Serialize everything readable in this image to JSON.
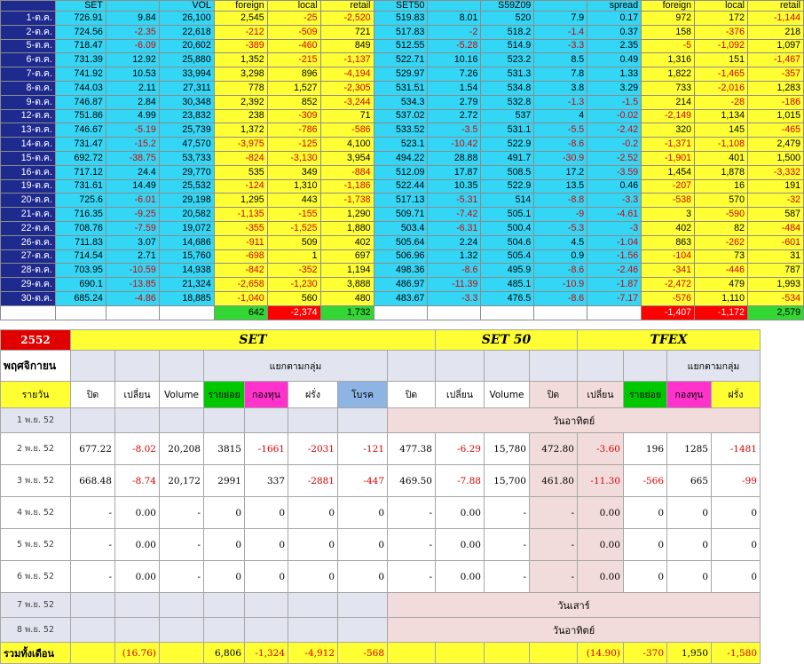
{
  "top_headers": [
    "",
    "SET",
    "",
    "VOL",
    "foreign",
    "local",
    "retail",
    "SET50",
    "",
    "S59Z09",
    "",
    "spread",
    "foreign",
    "local",
    "retail"
  ],
  "top_rows": [
    [
      "1-ต.ค.",
      "726.91",
      "9.84",
      "26,100",
      "2,545",
      "-25",
      "-2,520",
      "519.83",
      "8.01",
      "520",
      "7.9",
      "0.17",
      "972",
      "172",
      "-1,144"
    ],
    [
      "2-ต.ค.",
      "724.56",
      "-2.35",
      "22,618",
      "-212",
      "-509",
      "721",
      "517.83",
      "-2",
      "518.2",
      "-1.4",
      "0.37",
      "158",
      "-376",
      "218"
    ],
    [
      "5-ต.ค.",
      "718.47",
      "-6.09",
      "20,602",
      "-389",
      "-460",
      "849",
      "512.55",
      "-5.28",
      "514.9",
      "-3.3",
      "2.35",
      "-5",
      "-1,092",
      "1,097"
    ],
    [
      "6-ต.ค.",
      "731.39",
      "12.92",
      "25,880",
      "1,352",
      "-215",
      "-1,137",
      "522.71",
      "10.16",
      "523.2",
      "8.5",
      "0.49",
      "1,316",
      "151",
      "-1,467"
    ],
    [
      "7-ต.ค.",
      "741.92",
      "10.53",
      "33,994",
      "3,298",
      "896",
      "-4,194",
      "529.97",
      "7.26",
      "531.3",
      "7.8",
      "1.33",
      "1,822",
      "-1,465",
      "-357"
    ],
    [
      "8-ต.ค.",
      "744.03",
      "2.11",
      "27,311",
      "778",
      "1,527",
      "-2,305",
      "531.51",
      "1.54",
      "534.8",
      "3.8",
      "3.29",
      "733",
      "-2,016",
      "1,283"
    ],
    [
      "9-ต.ค.",
      "746.87",
      "2.84",
      "30,348",
      "2,392",
      "852",
      "-3,244",
      "534.3",
      "2.79",
      "532.8",
      "-1.3",
      "-1.5",
      "214",
      "-28",
      "-186"
    ],
    [
      "12-ต.ค.",
      "751.86",
      "4.99",
      "23,832",
      "238",
      "-309",
      "71",
      "537.02",
      "2.72",
      "537",
      "4",
      "-0.02",
      "-2,149",
      "1,134",
      "1,015"
    ],
    [
      "13-ต.ค.",
      "746.67",
      "-5.19",
      "25,739",
      "1,372",
      "-786",
      "-586",
      "533.52",
      "-3.5",
      "531.1",
      "-5.5",
      "-2.42",
      "320",
      "145",
      "-465"
    ],
    [
      "14-ต.ค.",
      "731.47",
      "-15.2",
      "47,570",
      "-3,975",
      "-125",
      "4,100",
      "523.1",
      "-10.42",
      "522.9",
      "-8.6",
      "-0.2",
      "-1,371",
      "-1,108",
      "2,479"
    ],
    [
      "15-ต.ค.",
      "692.72",
      "-38.75",
      "53,733",
      "-824",
      "-3,130",
      "3,954",
      "494.22",
      "28.88",
      "491.7",
      "-30.9",
      "-2.52",
      "-1,901",
      "401",
      "1,500"
    ],
    [
      "16-ต.ค.",
      "717.12",
      "24.4",
      "29,770",
      "535",
      "349",
      "-884",
      "512.09",
      "17.87",
      "508.5",
      "17.2",
      "-3.59",
      "1,454",
      "1,878",
      "-3,332"
    ],
    [
      "19-ต.ค.",
      "731.61",
      "14.49",
      "25,532",
      "-124",
      "1,310",
      "-1,186",
      "522.44",
      "10.35",
      "522.9",
      "13.5",
      "0.46",
      "-207",
      "16",
      "191"
    ],
    [
      "20-ต.ค.",
      "725.6",
      "-6.01",
      "29,198",
      "1,295",
      "443",
      "-1,738",
      "517.13",
      "-5.31",
      "514",
      "-8.8",
      "-3.3",
      "-538",
      "570",
      "-32"
    ],
    [
      "21-ต.ค.",
      "716.35",
      "-9.25",
      "20,582",
      "-1,135",
      "-155",
      "1,290",
      "509.71",
      "-7.42",
      "505.1",
      "-9",
      "-4.61",
      "3",
      "-590",
      "587"
    ],
    [
      "22-ต.ค.",
      "708.76",
      "-7.59",
      "19,072",
      "-355",
      "-1,525",
      "1,880",
      "503.4",
      "-6.31",
      "500.4",
      "-5.3",
      "-3",
      "402",
      "82",
      "-484"
    ],
    [
      "26-ต.ค.",
      "711.83",
      "3.07",
      "14,686",
      "-911",
      "509",
      "402",
      "505.64",
      "2.24",
      "504.6",
      "4.5",
      "-1.04",
      "863",
      "-262",
      "-601"
    ],
    [
      "27-ต.ค.",
      "714.54",
      "2.71",
      "15,760",
      "-698",
      "1",
      "697",
      "506.96",
      "1.32",
      "505.4",
      "0.9",
      "-1.56",
      "-104",
      "73",
      "31"
    ],
    [
      "28-ต.ค.",
      "703.95",
      "-10.59",
      "14,938",
      "-842",
      "-352",
      "1,194",
      "498.36",
      "-8.6",
      "495.9",
      "-8.6",
      "-2.46",
      "-341",
      "-446",
      "787"
    ],
    [
      "29-ต.ค.",
      "690.1",
      "-13.85",
      "21,324",
      "-2,658",
      "-1,230",
      "3,888",
      "486.97",
      "-11.39",
      "485.1",
      "-10.9",
      "-1.87",
      "-2,472",
      "479",
      "1,993"
    ],
    [
      "30-ต.ค.",
      "685.24",
      "-4.86",
      "18,885",
      "-1,040",
      "560",
      "480",
      "483.67",
      "-3.3",
      "476.5",
      "-8.6",
      "-7.17",
      "-576",
      "1,110",
      "-534"
    ]
  ],
  "top_totals": {
    "foreign": "642",
    "local": "-2,374",
    "retail": "1,732",
    "tfex_foreign": "-1,407",
    "tfex_local": "-1,172",
    "tfex_retail": "2,579"
  },
  "bottom": {
    "year": "2552",
    "set_title": "SET",
    "set50_title": "SET 50",
    "tfex_title": "TFEX",
    "month": "พฤศจิกายน",
    "group_label": "แยกตามกลุ่ม",
    "daily_label": "รายวัน",
    "col_close": "ปิด",
    "col_change": "เปลี่ยน",
    "col_volume": "Volume",
    "col_retail": "รายย่อย",
    "col_fund": "กองทุน",
    "col_foreign": "ฝรั่ง",
    "col_broker": "โบรค",
    "total_label": "รวมทั้งเดือน",
    "rows": [
      {
        "date": "1 พ.ย. 52",
        "note": "วันอาทิตย์"
      },
      {
        "date": "2 พ.ย. 52",
        "cells": [
          "677.22",
          "-8.02",
          "20,208",
          "3815",
          "-1661",
          "-2031",
          "-121",
          "477.38",
          "-6.29",
          "15,780",
          "472.80",
          "-3.60",
          "196",
          "1285",
          "-1481"
        ]
      },
      {
        "date": "3 พ.ย. 52",
        "cells": [
          "668.48",
          "-8.74",
          "20,172",
          "2991",
          "337",
          "-2881",
          "-447",
          "469.50",
          "-7.88",
          "15,700",
          "461.80",
          "-11.30",
          "-566",
          "665",
          "-99"
        ]
      },
      {
        "date": "4 พ.ย. 52",
        "cells": [
          "-",
          "0.00",
          "-",
          "0",
          "0",
          "0",
          "0",
          "-",
          "0.00",
          "-",
          "-",
          "0.00",
          "0",
          "0",
          "0"
        ]
      },
      {
        "date": "5 พ.ย. 52",
        "cells": [
          "-",
          "0.00",
          "-",
          "0",
          "0",
          "0",
          "0",
          "-",
          "0.00",
          "-",
          "-",
          "0.00",
          "0",
          "0",
          "0"
        ]
      },
      {
        "date": "6 พ.ย. 52",
        "cells": [
          "-",
          "0.00",
          "-",
          "0",
          "0",
          "0",
          "0",
          "-",
          "0.00",
          "-",
          "-",
          "0.00",
          "0",
          "0",
          "0"
        ]
      },
      {
        "date": "7 พ.ย. 52",
        "note": "วันเสาร์"
      },
      {
        "date": "8 พ.ย. 52",
        "note": "วันอาทิตย์"
      }
    ],
    "totals": [
      "",
      "(16.76)",
      "",
      "6,806",
      "-1,324",
      "-4,912",
      "-568",
      "",
      "",
      "",
      "",
      "(14.90)",
      "-370",
      "1,950",
      "-1,580"
    ]
  },
  "colors": {
    "date_bg": "#1f2a8f",
    "cyan": "#33d6f5",
    "yellow": "#ffff33",
    "green": "#33d633",
    "red": "#ff0000",
    "negative_text": "#d80000"
  }
}
